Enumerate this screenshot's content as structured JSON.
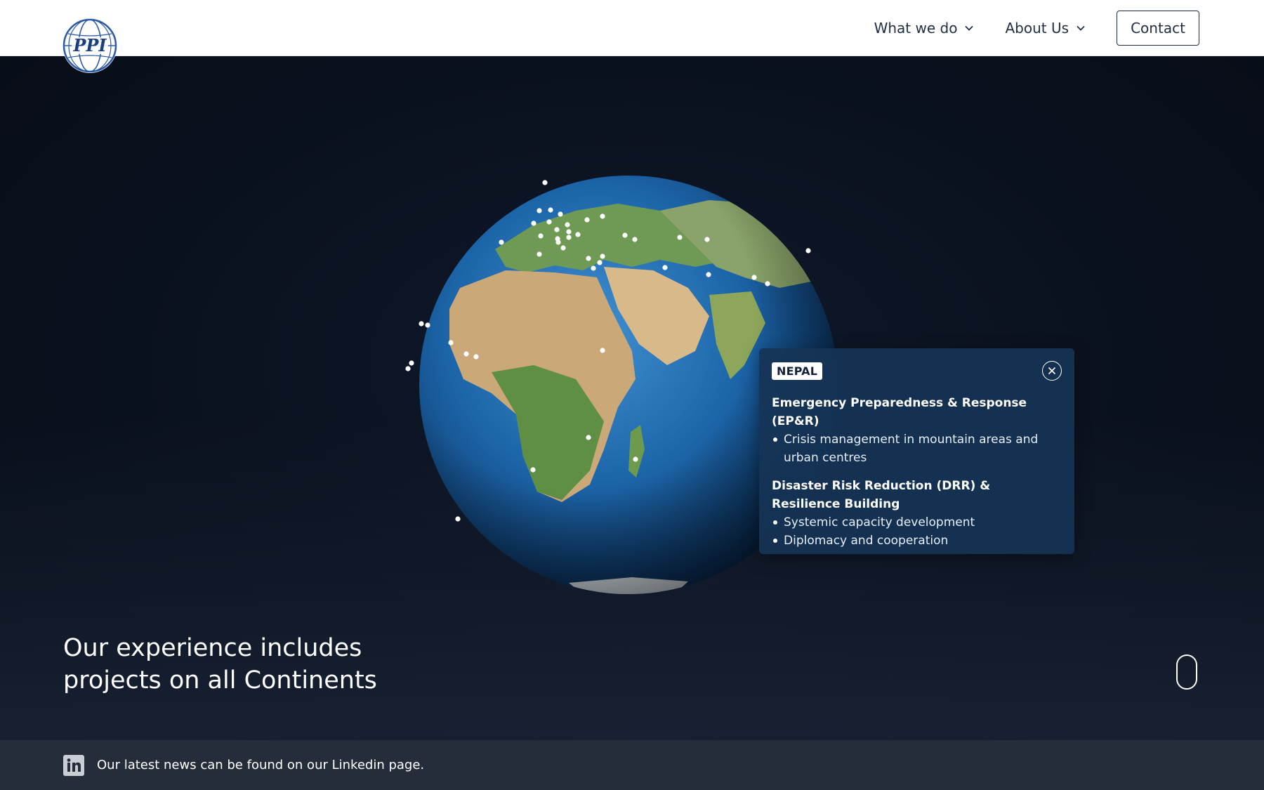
{
  "header": {
    "logo_text": "PPI",
    "nav": [
      {
        "label": "What we do"
      },
      {
        "label": "About Us"
      }
    ],
    "contact_label": "Contact"
  },
  "hero": {
    "title_line1": "Our experience includes",
    "title_line2": "projects on all Continents"
  },
  "popup": {
    "country": "NEPAL",
    "sections": [
      {
        "title": "Emergency Preparedness & Response (EP&R)",
        "items": [
          "Crisis management in mountain areas and urban centres"
        ]
      },
      {
        "title": "Disaster Risk Reduction (DRR) & Resilience Building",
        "items": [
          "Systemic capacity development",
          "Diplomacy and cooperation"
        ]
      }
    ]
  },
  "footer": {
    "text": "Our latest news can be found on our Linkedin page."
  },
  "icons": {
    "logo": "globe-logo-icon",
    "nav_chevron": "chevron-down-icon",
    "close": "close-icon",
    "linkedin": "linkedin-icon",
    "scroll": "mouse-scroll-icon"
  },
  "colors": {
    "header_bg": "#ffffff",
    "nav_text": "#1f2d44",
    "hero_bg": "#0a0f1a",
    "popup_bg": "#163456",
    "footer_bg": "#262d3a"
  }
}
